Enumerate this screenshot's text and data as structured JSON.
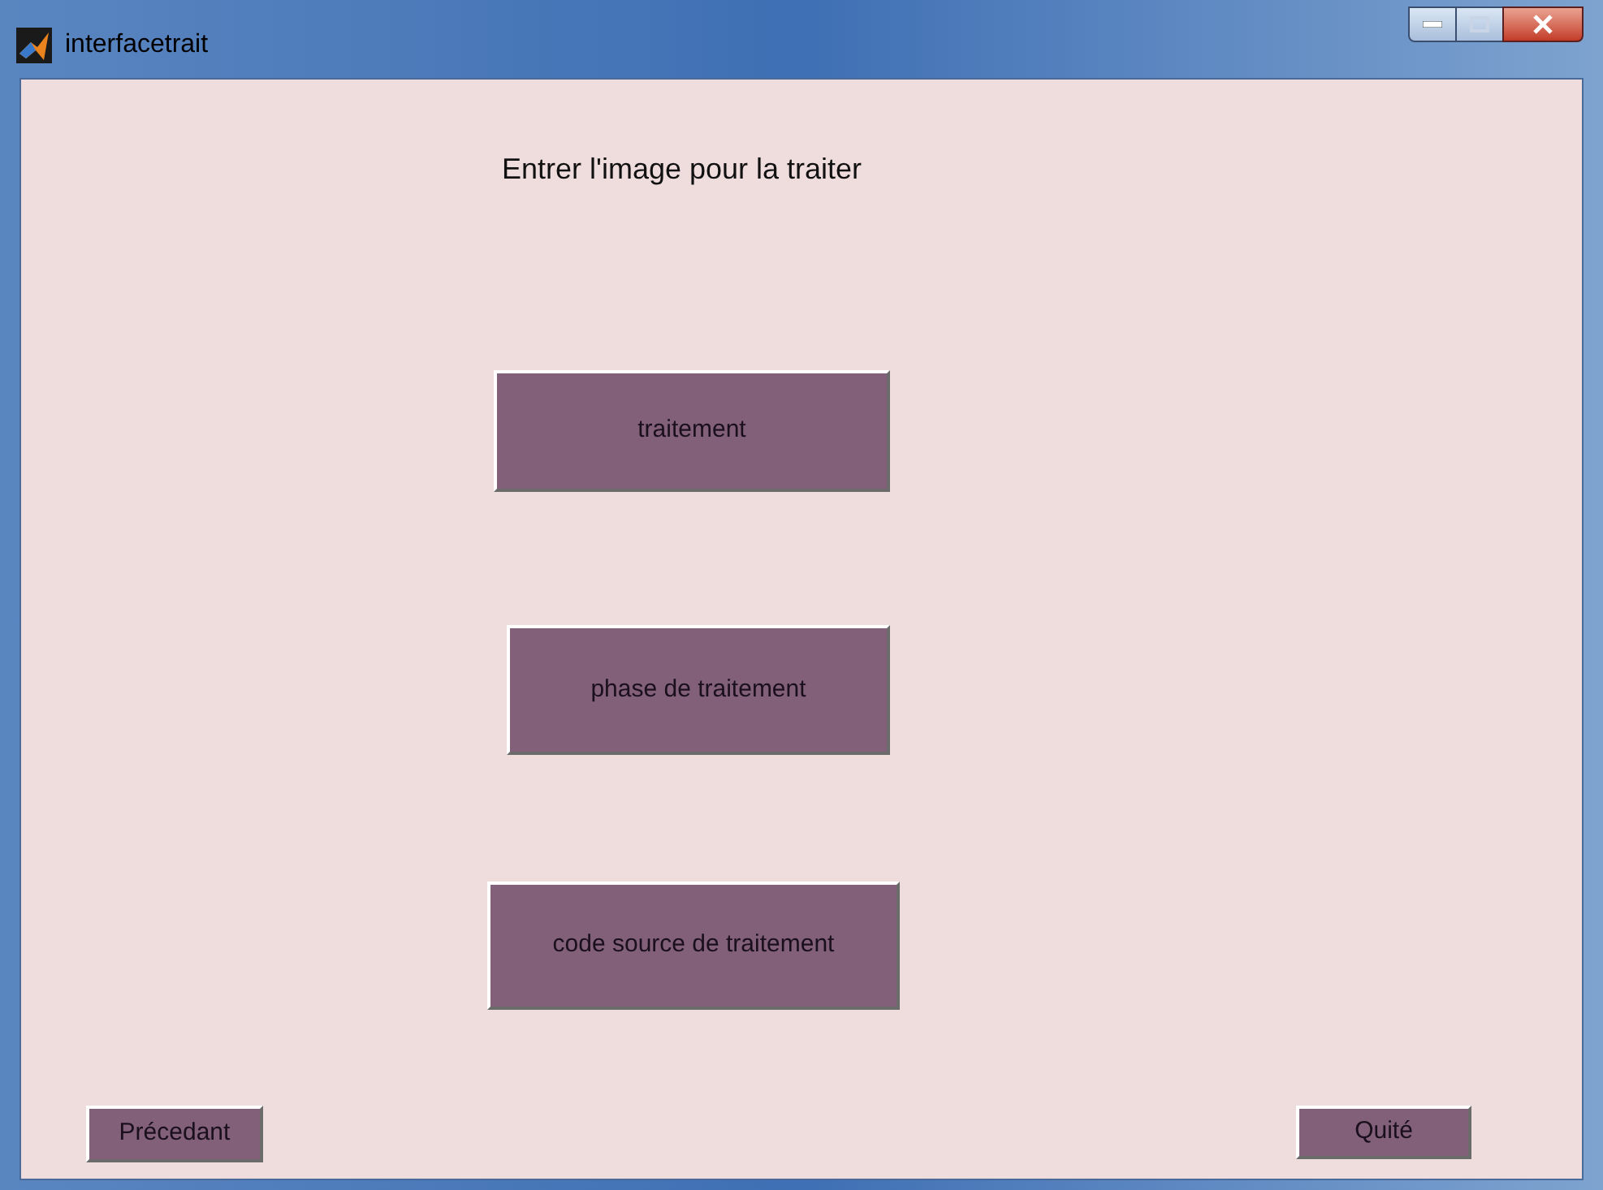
{
  "window": {
    "title": "interfacetrait"
  },
  "heading": "Entrer l'image pour la traiter",
  "buttons": [
    {
      "label": "traitement"
    },
    {
      "label": "phase de traitement"
    },
    {
      "label": "code source de traitement"
    }
  ],
  "footer_buttons": [
    {
      "label": "Précedant"
    },
    {
      "label": "Quité"
    }
  ]
}
